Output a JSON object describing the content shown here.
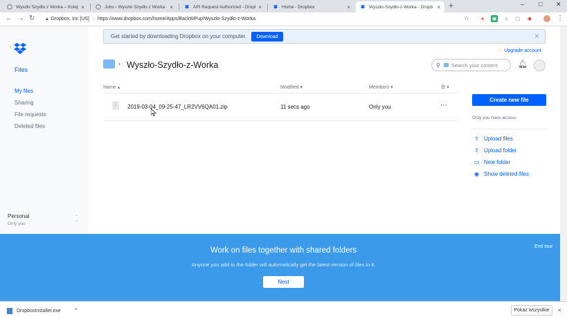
{
  "browser": {
    "tabs": [
      {
        "title": "Wyszło Szydło z Worka – Kolejn…",
        "favicon": "globe-icon",
        "active": false
      },
      {
        "title": "Jobs ‹ Wyszło Szydło z Worka —",
        "favicon": "globe-icon",
        "active": false
      },
      {
        "title": "API Request Authorized - Dropb",
        "favicon": "dropbox-icon",
        "active": false
      },
      {
        "title": "Home - Dropbox",
        "favicon": "dropbox-icon",
        "active": false
      },
      {
        "title": "Wyszło-Szydło-z-Worka - Dropb",
        "favicon": "dropbox-icon",
        "active": true
      }
    ],
    "site_identity": "Dropbox, Inc [US]",
    "url": "https://www.dropbox.com/home/Apps/BackWPup/Wyszło-Szydło-z-Worka"
  },
  "banner": {
    "text": "Get started by downloading Dropbox on your computer.",
    "button": "Download"
  },
  "sidebar": {
    "title": "Files",
    "items": [
      "My files",
      "Sharing",
      "File requests",
      "Deleted files"
    ],
    "account_name": "Personal",
    "account_sub": "Only you"
  },
  "header": {
    "upgrade": "Upgrade account",
    "folder_title": "Wyszło-Szydło-z-Worka",
    "search_placeholder": "Search your content"
  },
  "table": {
    "columns": {
      "name": "Name",
      "modified": "Modified",
      "members": "Members"
    },
    "rows": [
      {
        "name": "2019-03-04_09-25-47_LR2VV6QA01.zip",
        "modified": "11 secs ago",
        "members": "Only you"
      }
    ]
  },
  "actions": {
    "create": "Create new file",
    "access": "Only you have access",
    "links": [
      "Upload files",
      "Upload folder",
      "New folder",
      "Show deleted files"
    ]
  },
  "tour": {
    "title": "Work on files together with shared folders",
    "subtitle": "Anyone you add to the folder will automatically get the latest version of files in it.",
    "next": "Next",
    "end": "End tour"
  },
  "downloads": {
    "file": "DropboxInstaller.exe",
    "show_all": "Pokaż wszystkie"
  },
  "colors": {
    "accent": "#0061fe",
    "tour_bg": "#3b9ae9",
    "banner_bg": "#e7f0fb"
  }
}
